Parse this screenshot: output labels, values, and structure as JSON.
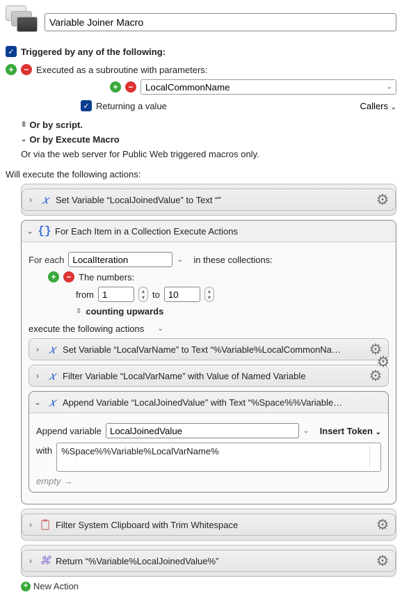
{
  "header": {
    "title": "Variable Joiner Macro"
  },
  "trigger": {
    "heading": "Triggered by any of the following:",
    "subroutine": "Executed as a subroutine with parameters:",
    "param_value": "LocalCommonName",
    "returning": "Returning a value",
    "callers_label": "Callers",
    "or_script": "Or by script.",
    "or_execute_macro": "Or by Execute Macro",
    "or_web": "Or via the web server for Public Web triggered macros only."
  },
  "exec_heading": "Will execute the following actions:",
  "actions": {
    "set_joined": "Set Variable “LocalJoinedValue” to Text “”",
    "foreach": {
      "title": "For Each Item in a Collection Execute Actions",
      "foreach_label": "For each",
      "var_value": "LocalIteration",
      "in_label": "in these collections:",
      "numbers_label": "The numbers:",
      "from_label": "from",
      "from_value": "1",
      "to_label": "to",
      "to_value": "10",
      "counting": "counting upwards",
      "exec_following": "execute the following actions",
      "sub": {
        "set_varname": "Set Variable “LocalVarName” to Text “%Variable%LocalCommonNa…",
        "filter_varname": "Filter Variable “LocalVarName” with Value of Named Variable",
        "append": {
          "title": "Append Variable “LocalJoinedValue” with Text “%Space%%Variable…",
          "append_label": "Append variable",
          "var_value": "LocalJoinedValue",
          "insert_token": "Insert Token",
          "with_label": "with",
          "with_value": "%Space%%Variable%LocalVarName%",
          "empty": "empty",
          "arrow": "→"
        }
      }
    },
    "filter_clip": "Filter System Clipboard with Trim Whitespace",
    "return": "Return “%Variable%LocalJoinedValue%”"
  },
  "new_action": "New Action"
}
